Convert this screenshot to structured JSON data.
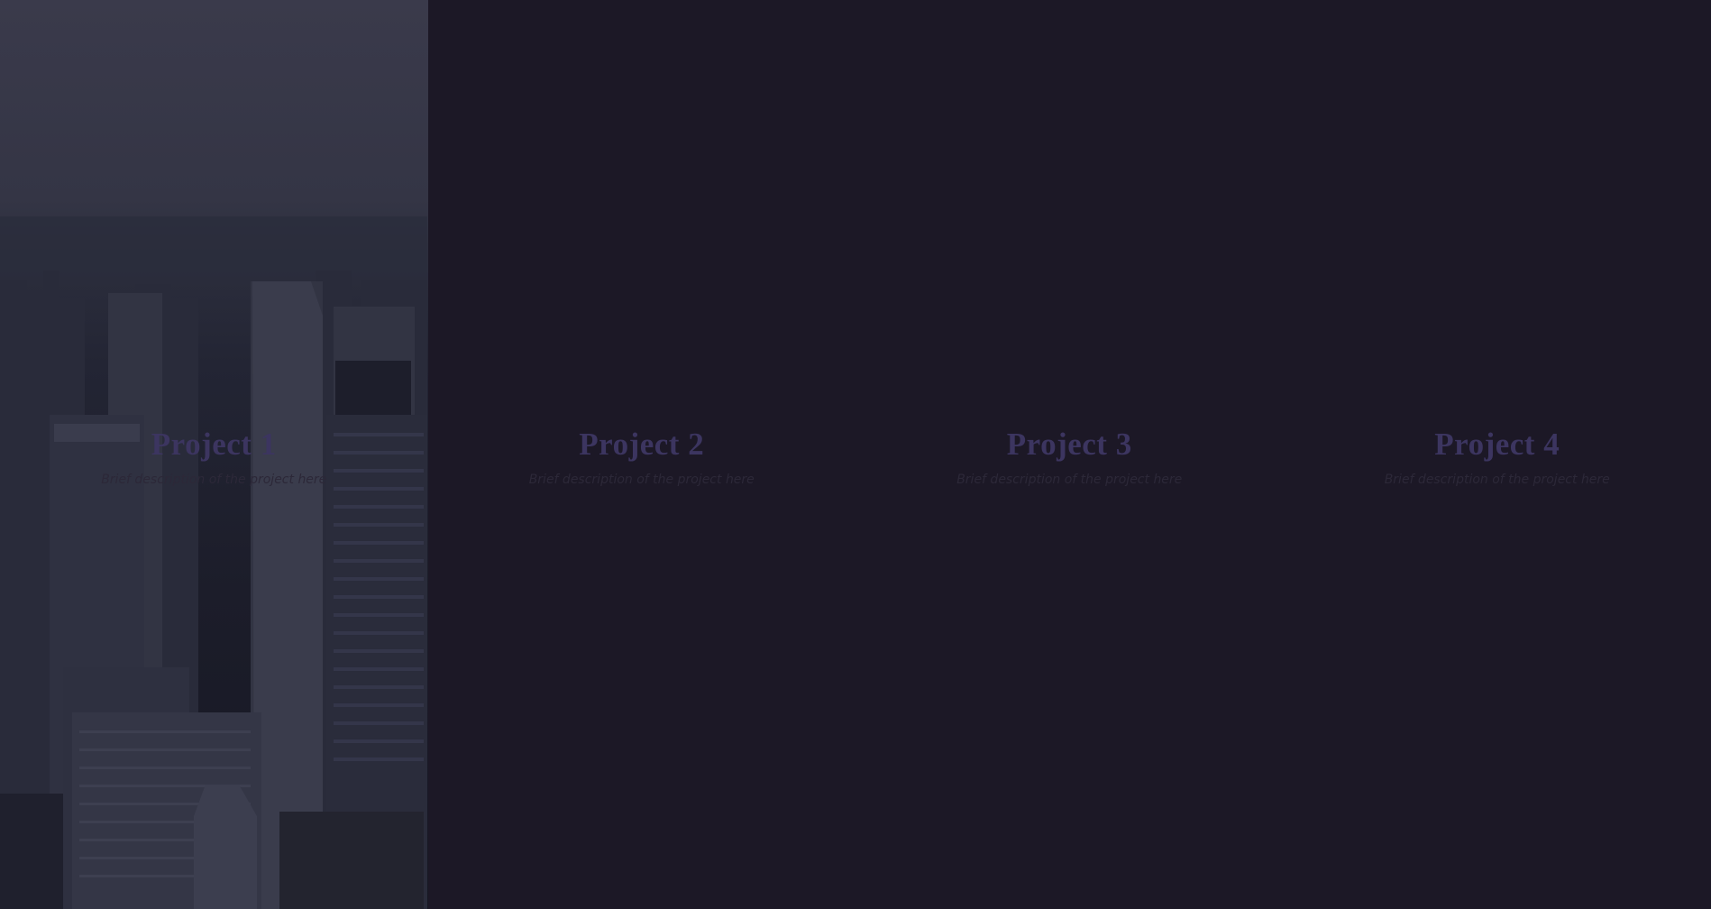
{
  "projects": [
    {
      "title": "Project 1",
      "description": "Brief description of the project here"
    },
    {
      "title": "Project 2",
      "description": "Brief description of the project here"
    },
    {
      "title": "Project 3",
      "description": "Brief description of the project here"
    },
    {
      "title": "Project 4",
      "description": "Brief description of the project here"
    }
  ],
  "colors": {
    "background": "#1c1826",
    "title": "#3c3560",
    "description": "#2c2838"
  }
}
